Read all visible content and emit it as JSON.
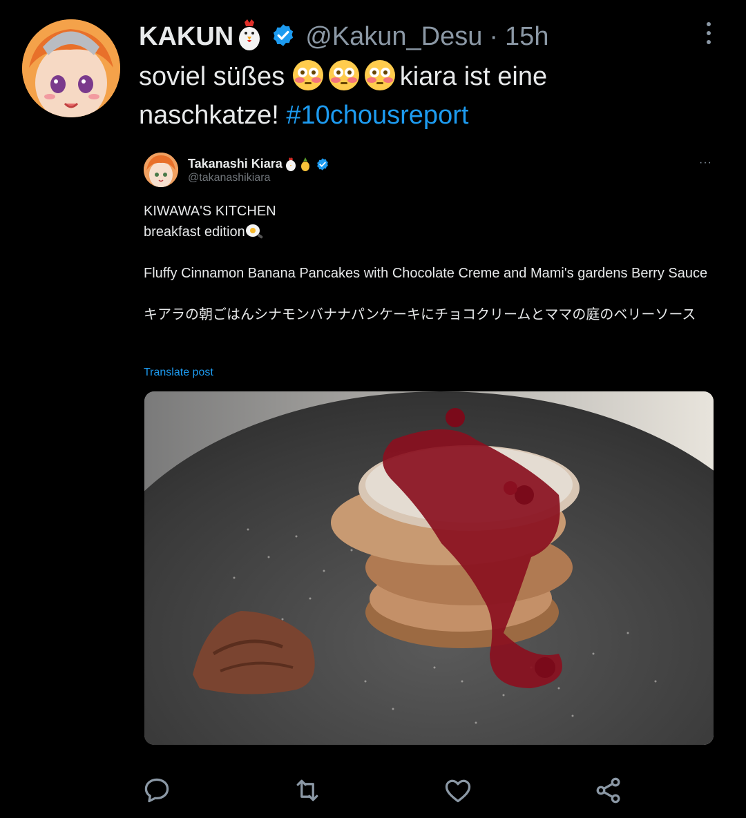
{
  "tweet": {
    "display_name": "KAKUN",
    "handle": "@Kakun_Desu",
    "separator": "·",
    "time": "15h",
    "text_part1": "soviel süßes",
    "text_part2": "kiara ist eine",
    "text_part3": "naschkatze! ",
    "hashtag": "#10chousreport",
    "avatar_icon": "anime-avatar-icon",
    "name_emoji": "chicken-emoji-icon",
    "inline_emoji": "flushed-face-emoji"
  },
  "quote": {
    "display_name": "Takanashi Kiara",
    "handle": "@takanashikiara",
    "more_label": "···",
    "line1": "KIWAWA'S KITCHEN",
    "line2": "breakfast edition",
    "line3": "Fluffy Cinnamon Banana Pancakes with Chocolate Creme and Mami's gardens Berry Sauce",
    "line4": "キアラの朝ごはんシナモンバナナパンケーキにチョコクリームとママの庭のベリーソース",
    "translate_label": "Translate post",
    "photo_icon": "pancakes-photo"
  },
  "actions": [
    "reply-icon",
    "repost-icon",
    "like-icon",
    "share-icon"
  ],
  "colors": {
    "background": "#000000",
    "text": "#e7e9ea",
    "muted": "#8b98a5",
    "accent": "#1d9bf0"
  }
}
